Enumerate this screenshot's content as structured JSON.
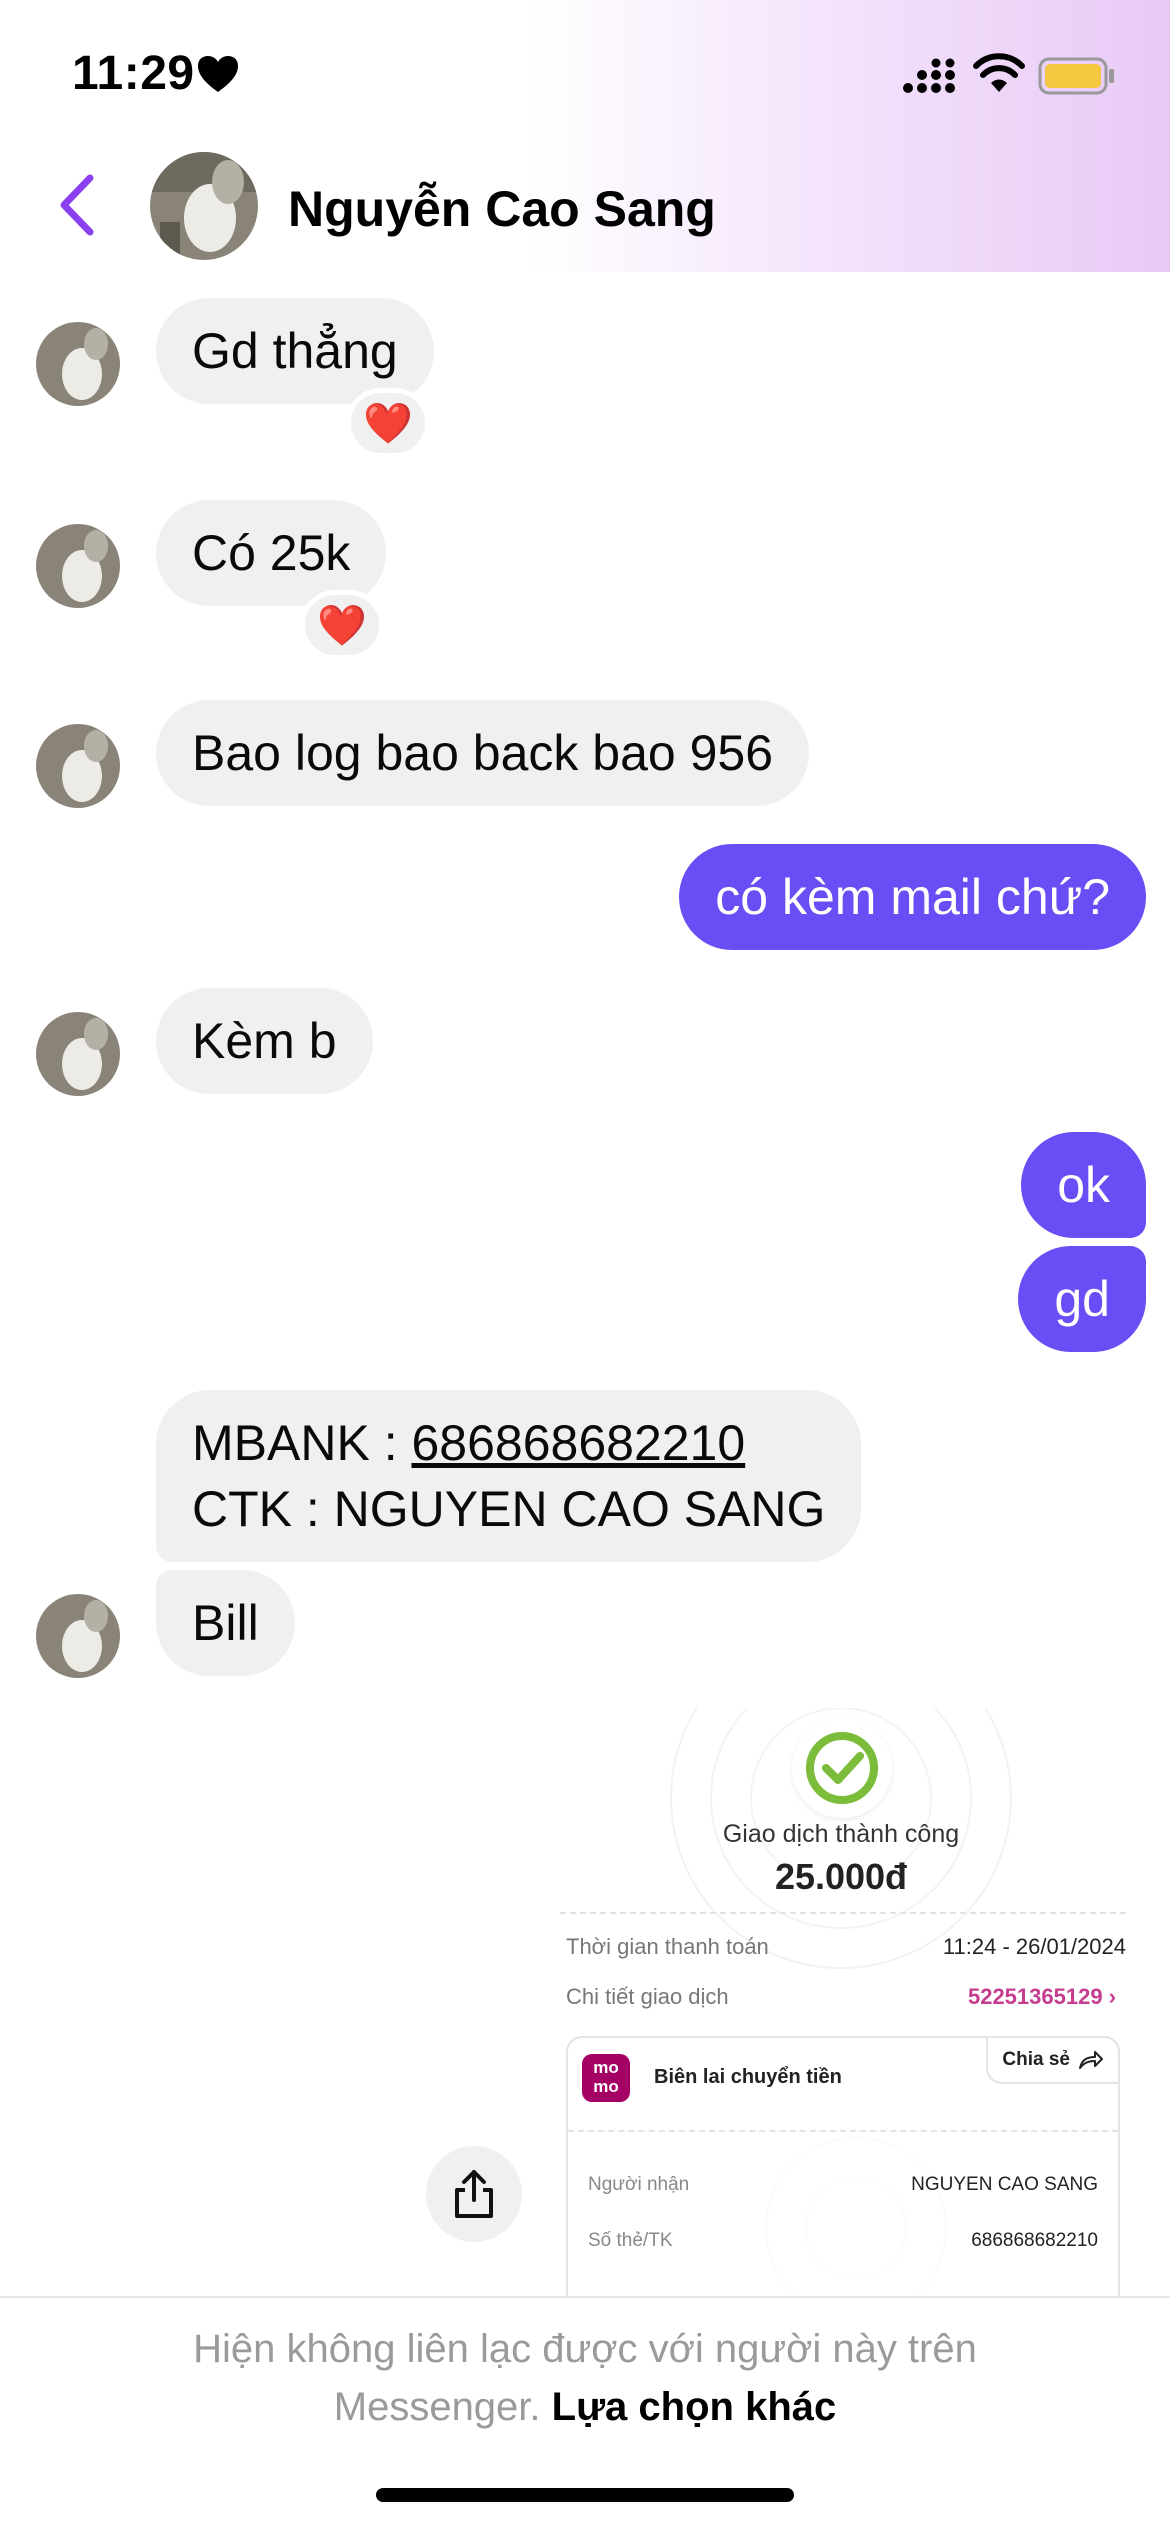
{
  "status_bar": {
    "time": "11:29",
    "focus_icon": "heart-icon",
    "battery_color": "#f5c842"
  },
  "header": {
    "contact_name": "Nguyễn Cao Sang",
    "back_icon": "chevron-left-icon",
    "accent": "#8a3ff0"
  },
  "messages": [
    {
      "side": "in",
      "text": "Gd thẳng",
      "reaction": "❤️"
    },
    {
      "side": "in",
      "text": "Có 25k",
      "reaction": "❤️"
    },
    {
      "side": "in",
      "text": "Bao log bao back bao 956"
    },
    {
      "side": "out",
      "text": "có kèm mail chứ?"
    },
    {
      "side": "in",
      "text": "Kèm b"
    },
    {
      "side": "out",
      "text": "ok"
    },
    {
      "side": "out",
      "text": "gd"
    },
    {
      "side": "in",
      "line1_prefix": "MBANK : ",
      "line1_number": "686868682210",
      "line2": "CTK : NGUYEN CAO SANG"
    },
    {
      "side": "in",
      "text": "Bill"
    }
  ],
  "receipt": {
    "status": "Giao dịch thành công",
    "amount": "25.000đ",
    "time_label": "Thời gian thanh toán",
    "time_value": "11:24 - 26/01/2024",
    "detail_label": "Chi tiết giao dịch",
    "detail_value": "52251365129 ›",
    "share_label": "Chia sẻ",
    "card_title": "Biên lai chuyển tiền",
    "momo_logo": "mo mo",
    "recipient_label": "Người nhận",
    "recipient_value": "NGUYEN CAO SANG",
    "account_label": "Số thẻ/TK",
    "account_value": "686868682210"
  },
  "bubble_colors": {
    "incoming": "#f0f0f0",
    "outgoing": "#6a4df5"
  },
  "footer": {
    "text_part1": "Hiện không liên lạc được với người này trên",
    "text_part2": "Messenger.",
    "link": "Lựa chọn khác"
  }
}
